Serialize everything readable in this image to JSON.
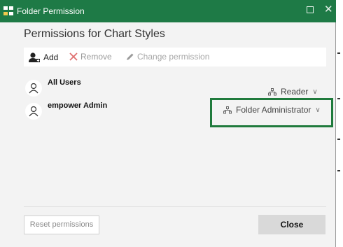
{
  "window": {
    "title": "Folder Permission"
  },
  "heading": "Permissions for Chart Styles",
  "toolbar": {
    "add_label": "Add",
    "remove_label": "Remove",
    "change_label": "Change permission"
  },
  "users": [
    {
      "name": "All Users",
      "permission": "Reader"
    },
    {
      "name": "empower Admin",
      "permission": "Folder Administrator"
    }
  ],
  "footer": {
    "reset_label": "Reset permissions",
    "close_label": "Close"
  },
  "colors": {
    "accent": "#1e7a46",
    "highlight": "#1f7a3c"
  }
}
